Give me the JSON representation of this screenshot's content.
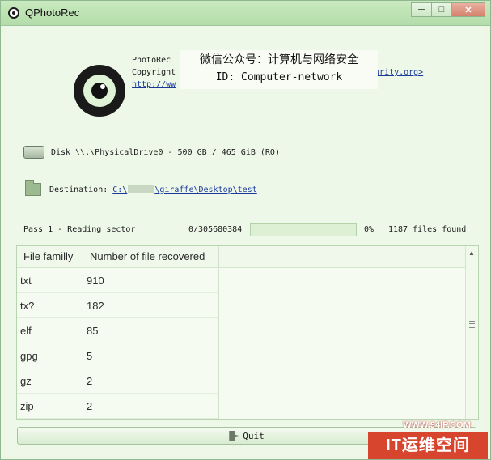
{
  "window": {
    "title": "QPhotoRec",
    "controls": {
      "minimize": "─",
      "maximize": "□",
      "close": "✕"
    }
  },
  "about": {
    "name": "PhotoRec",
    "copyright": "Copyright",
    "link_prefix": "http://ww",
    "link_suffix": "urity.org>"
  },
  "overlay": {
    "line1": "微信公众号：计算机与网络安全",
    "line2": "ID: Computer-network"
  },
  "disk": {
    "label": "Disk \\\\.\\PhysicalDrive0 - 500 GB / 465 GiB (RO)"
  },
  "destination": {
    "label": "Destination:",
    "path_prefix": "C:\\",
    "path_suffix": "\\giraffe\\Desktop\\test"
  },
  "progress": {
    "pass_label": "Pass 1 - Reading sector",
    "sector": "0/305680384",
    "fraction": 0.0,
    "percent": "0%",
    "files_found": "1187 files found"
  },
  "table": {
    "headers": [
      "File familly",
      "Number of file recovered"
    ],
    "rows": [
      [
        "txt",
        "910"
      ],
      [
        "tx?",
        "182"
      ],
      [
        "elf",
        "85"
      ],
      [
        "gpg",
        "5"
      ],
      [
        "gz",
        "2"
      ],
      [
        "zip",
        "2"
      ]
    ]
  },
  "quit_label": "Quit",
  "watermark": {
    "url": "WWW.94IP.COM",
    "brand": "IT运维空间"
  }
}
